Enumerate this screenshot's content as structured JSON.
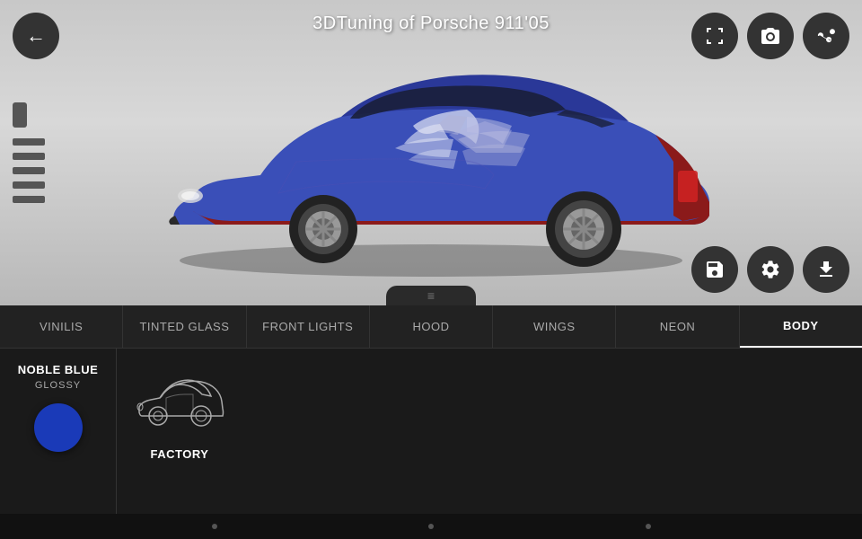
{
  "header": {
    "title": "3DTuning of Porsche 911'05",
    "back_label": "←"
  },
  "top_buttons": [
    {
      "name": "fullscreen-button",
      "icon": "fullscreen"
    },
    {
      "name": "camera-button",
      "icon": "camera"
    },
    {
      "name": "share-button",
      "icon": "share"
    }
  ],
  "bottom_buttons": [
    {
      "name": "save-button",
      "icon": "save"
    },
    {
      "name": "settings-button",
      "icon": "settings"
    },
    {
      "name": "download-button",
      "icon": "download"
    }
  ],
  "tabs": [
    {
      "label": "VINILIS",
      "active": false
    },
    {
      "label": "TINTED GLASS",
      "active": false
    },
    {
      "label": "FRONT LIGHTS",
      "active": false
    },
    {
      "label": "HOOD",
      "active": false
    },
    {
      "label": "WINGS",
      "active": false
    },
    {
      "label": "NEON",
      "active": false
    },
    {
      "label": "BODY",
      "active": true
    }
  ],
  "color_info": {
    "name": "NOBLE BLUE",
    "type": "GLOSSY",
    "swatch_color": "#1a3ab8"
  },
  "options": [
    {
      "label": "FACTORY",
      "thumbnail_type": "car-outline"
    }
  ],
  "bottom_nav_dots": [
    "dot1",
    "dot2",
    "dot3"
  ]
}
